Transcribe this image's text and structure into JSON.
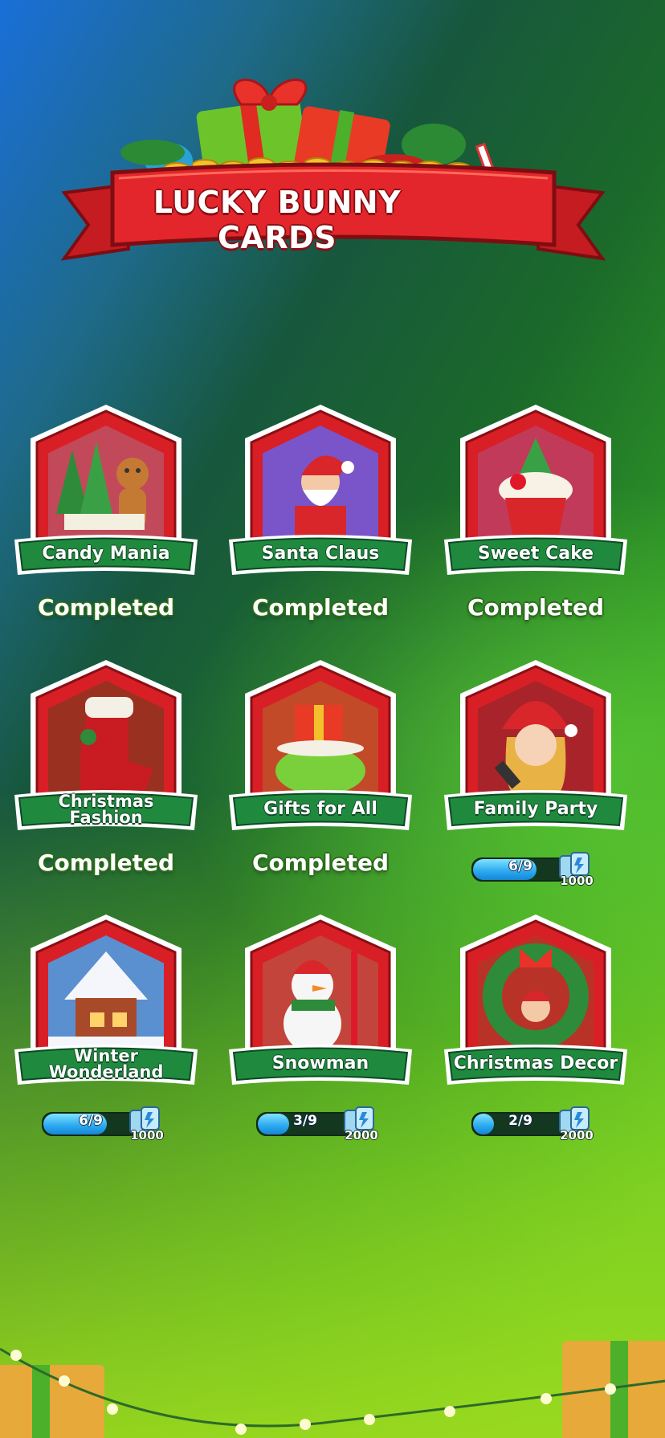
{
  "header": {
    "title": "LUCKY BUNNY CARDS"
  },
  "colors": {
    "frame_red": "#d81f26",
    "ribbon_green": "#1f8a3e",
    "progress_blue": "#2aa7ef"
  },
  "cards": [
    {
      "title": "Candy Mania",
      "status": "Completed",
      "art": "gingerbread-trees-icon"
    },
    {
      "title": "Santa Claus",
      "status": "Completed",
      "art": "santa-icon"
    },
    {
      "title": "Sweet Cake",
      "status": "Completed",
      "art": "cupcake-icon"
    },
    {
      "title": "Christmas Fashion",
      "status": "Completed",
      "art": "stocking-boot-icon"
    },
    {
      "title": "Gifts for All",
      "status": "Completed",
      "art": "gift-sack-icon"
    },
    {
      "title": "Family Party",
      "status": "",
      "art": "singer-girl-icon",
      "progress": {
        "text": "6/9",
        "fraction": 0.667
      },
      "reward": "1000"
    },
    {
      "title": "Winter Wonderland",
      "status": "",
      "art": "snowy-house-icon",
      "progress": {
        "text": "6/9",
        "fraction": 0.667
      },
      "reward": "1000"
    },
    {
      "title": "Snowman",
      "status": "",
      "art": "snowman-icon",
      "progress": {
        "text": "3/9",
        "fraction": 0.333
      },
      "reward": "2000"
    },
    {
      "title": "Christmas Decor",
      "status": "",
      "art": "wreath-icon",
      "progress": {
        "text": "2/9",
        "fraction": 0.222
      },
      "reward": "2000"
    }
  ]
}
